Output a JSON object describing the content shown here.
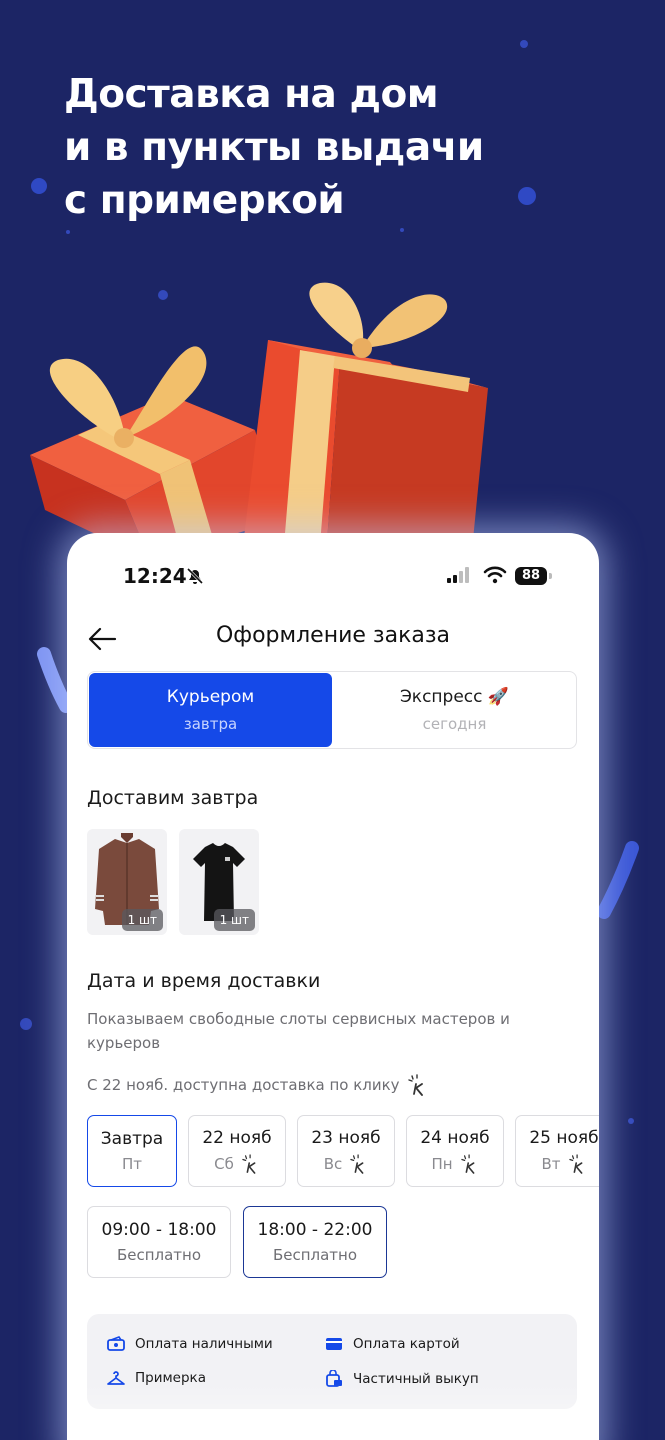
{
  "promo": {
    "headline": [
      "Доставка на дом",
      "и в пункты выдачи",
      "с примеркой"
    ]
  },
  "status": {
    "time": "12:24",
    "battery": "88"
  },
  "nav": {
    "title": "Оформление заказа"
  },
  "delivery_modes": [
    {
      "label": "Курьером",
      "sub": "завтра",
      "selected": true
    },
    {
      "label": "Экспресс",
      "sub": "сегодня",
      "selected": false,
      "icon": "rocket-icon"
    }
  ],
  "section": {
    "deliver_title": "Доставим завтра",
    "datetime_title": "Дата и время доставки"
  },
  "products": [
    {
      "name": "jacket",
      "qty": "1 шт"
    },
    {
      "name": "tshirt",
      "qty": "1 шт"
    }
  ],
  "datetime": {
    "description": "Показываем свободные слоты сервисных мастеров и курьеров",
    "click_note": "С 22 нояб. доступна доставка по клику"
  },
  "dates": [
    {
      "date": "Завтра",
      "weekday": "Пт",
      "click": false,
      "selected": true
    },
    {
      "date": "22 нояб",
      "weekday": "Сб",
      "click": true,
      "selected": false
    },
    {
      "date": "23 нояб",
      "weekday": "Вс",
      "click": true,
      "selected": false
    },
    {
      "date": "24 нояб",
      "weekday": "Пн",
      "click": true,
      "selected": false
    },
    {
      "date": "25 нояб",
      "weekday": "Вт",
      "click": true,
      "selected": false
    }
  ],
  "time_slots": [
    {
      "time": "09:00 - 18:00",
      "price": "Бесплатно",
      "selected": false
    },
    {
      "time": "18:00 - 22:00",
      "price": "Бесплатно",
      "selected": true
    }
  ],
  "features": [
    {
      "label": "Оплата наличными",
      "icon": "cash-icon"
    },
    {
      "label": "Оплата картой",
      "icon": "card-icon"
    },
    {
      "label": "Примерка",
      "icon": "hanger-icon"
    },
    {
      "label": "Частичный выкуп",
      "icon": "partial-buyout-icon"
    }
  ],
  "colors": {
    "accent": "#1549e8",
    "background": "#1c2565"
  }
}
